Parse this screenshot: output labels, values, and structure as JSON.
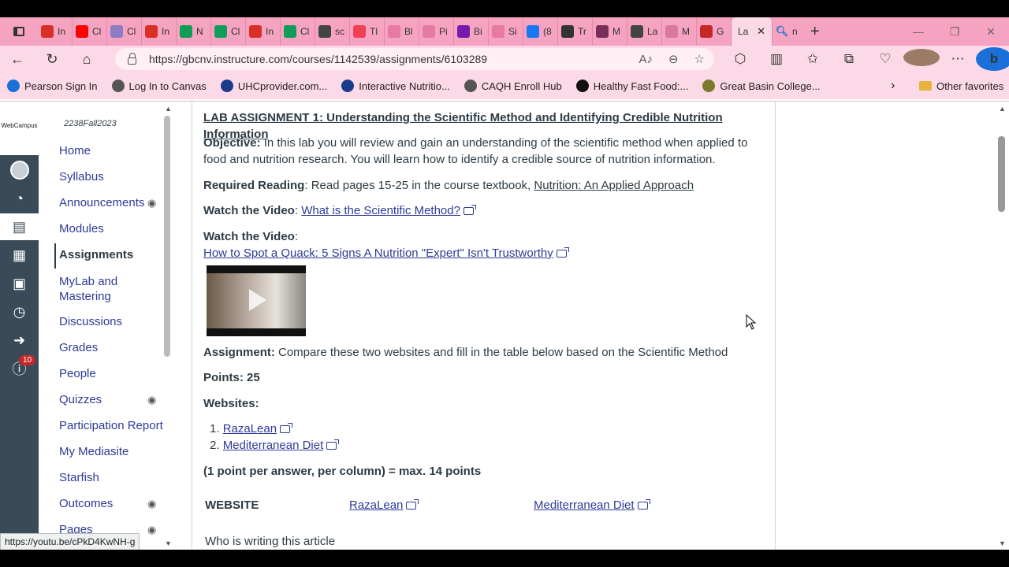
{
  "browser": {
    "tabs": [
      {
        "icon": "gmail-icon",
        "label": "In",
        "color": "#d93025"
      },
      {
        "icon": "youtube-icon",
        "label": "Cl",
        "color": "#ff0000"
      },
      {
        "icon": "calendar-icon",
        "label": "Cl",
        "color": "#8e7cc3"
      },
      {
        "icon": "gmail-icon",
        "label": "In",
        "color": "#d93025"
      },
      {
        "icon": "sheets-icon",
        "label": "N",
        "color": "#0f9d58"
      },
      {
        "icon": "sheets-icon",
        "label": "Cl",
        "color": "#0f9d58"
      },
      {
        "icon": "gmail-icon",
        "label": "In",
        "color": "#d93025"
      },
      {
        "icon": "sheets-icon",
        "label": "Cl",
        "color": "#0f9d58"
      },
      {
        "icon": "box-icon",
        "label": "sc",
        "color": "#444444"
      },
      {
        "icon": "pocket-icon",
        "label": "Tl",
        "color": "#ef4056"
      },
      {
        "icon": "image-icon",
        "label": "Bl",
        "color": "#e57ba0"
      },
      {
        "icon": "image-icon",
        "label": "Pi",
        "color": "#e57ba0"
      },
      {
        "icon": "onenote-icon",
        "label": "Bi",
        "color": "#7719aa"
      },
      {
        "icon": "image-icon",
        "label": "Si",
        "color": "#e57ba0"
      },
      {
        "icon": "facebook-icon",
        "label": "(8",
        "color": "#1877f2"
      },
      {
        "icon": "sn-icon",
        "label": "Tr",
        "color": "#333333"
      },
      {
        "icon": "c-icon",
        "label": "M",
        "color": "#7a2e5a"
      },
      {
        "icon": "document-icon",
        "label": "La",
        "color": "#444444"
      },
      {
        "icon": "puzzle-icon",
        "label": "M",
        "color": "#d97a9c"
      },
      {
        "icon": "flag-icon",
        "label": "G",
        "color": "#c62828"
      }
    ],
    "active_tab": {
      "label": "La"
    },
    "search_tab": {
      "label": "n"
    },
    "new_tab": "+",
    "url": "https://gbcnv.instructure.com/courses/1142539/assignments/6103289",
    "favorites": [
      {
        "label": "Pearson Sign In",
        "icon": "pearson-icon",
        "color": "#1a6fd8"
      },
      {
        "label": "Log In to Canvas",
        "icon": "canvas-icon",
        "color": "#555555"
      },
      {
        "label": "UHCprovider.com...",
        "icon": "uhc-icon",
        "color": "#1a3a8a"
      },
      {
        "label": "Interactive Nutritio...",
        "icon": "fda-icon",
        "color": "#1a3a8a"
      },
      {
        "label": "CAQH Enroll Hub",
        "icon": "document-icon",
        "color": "#555555"
      },
      {
        "label": "Healthy Fast Food:...",
        "icon": "g-icon",
        "color": "#111111"
      },
      {
        "label": "Great Basin College...",
        "icon": "gbc-icon",
        "color": "#7a7a2a"
      }
    ],
    "other_favorites": "Other favorites",
    "status_url": "https://youtu.be/cPkD4KwNH-g"
  },
  "global_nav": {
    "logo_text": "WebCampus",
    "inbox_badge": "10"
  },
  "course_nav": {
    "term": "2238Fall2023",
    "items": [
      {
        "label": "Home",
        "hidden": false
      },
      {
        "label": "Syllabus",
        "hidden": false
      },
      {
        "label": "Announcements",
        "hidden": true
      },
      {
        "label": "Modules",
        "hidden": false
      },
      {
        "label": "Assignments",
        "hidden": false,
        "active": true
      },
      {
        "label": "MyLab and Mastering",
        "hidden": false
      },
      {
        "label": "Discussions",
        "hidden": false
      },
      {
        "label": "Grades",
        "hidden": false
      },
      {
        "label": "People",
        "hidden": false
      },
      {
        "label": "Quizzes",
        "hidden": true
      },
      {
        "label": "Participation Report",
        "hidden": false
      },
      {
        "label": "My Mediasite",
        "hidden": false
      },
      {
        "label": "Starfish",
        "hidden": false
      },
      {
        "label": "Outcomes",
        "hidden": true
      },
      {
        "label": "Pages",
        "hidden": true
      }
    ]
  },
  "assignment": {
    "title": "LAB ASSIGNMENT 1: Understanding the Scientific Method and Identifying Credible Nutrition Information",
    "objective_label": "Objective:",
    "objective_text": " In this lab you will review and gain an understanding of the scientific method when applied to food and nutrition research.  You will learn how to identify a credible source of nutrition information.",
    "reading_label": "Required Reading",
    "reading_text": ": Read pages 15-25 in the course textbook, ",
    "reading_book": "Nutrition: An Applied Approach",
    "video1_label": "Watch the Video",
    "video1_sep": ": ",
    "video1_link": "What is the Scientific Method?",
    "video2_label": "Watch the Video",
    "video2_sep": ":",
    "video2_link": "How to Spot a Quack: 5 Signs A Nutrition \"Expert\" Isn't Trustworthy",
    "assignment_label": "Assignment:",
    "assignment_text": "  Compare these two websites and fill in the table below based on the Scientific Method",
    "points_label": "Points: 25",
    "websites_label": "Websites:",
    "websites": [
      "RazaLean",
      "Mediterranean Diet"
    ],
    "scoring_note": "(1 point per answer, per column) = max. 14 points",
    "table": {
      "header_label": "WEBSITE",
      "columns": [
        "RazaLean",
        "Mediterranean Diet"
      ],
      "first_row": "Who is writing this article"
    }
  }
}
